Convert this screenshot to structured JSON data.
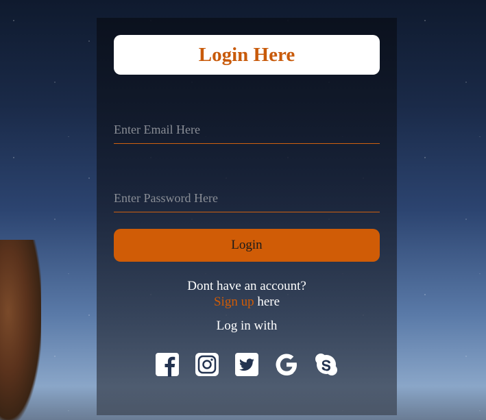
{
  "login": {
    "title": "Login Here",
    "email_placeholder": "Enter Email Here",
    "password_placeholder": "Enter Password Here",
    "login_button": "Login",
    "no_account": "Dont have an account?",
    "signup_link": "Sign up",
    "signup_suffix": " here",
    "login_with": "Log in with",
    "socials": [
      "facebook-icon",
      "instagram-icon",
      "twitter-icon",
      "google-icon",
      "skype-icon"
    ]
  },
  "colors": {
    "accent": "#d05c06",
    "title": "#c85a0a"
  }
}
